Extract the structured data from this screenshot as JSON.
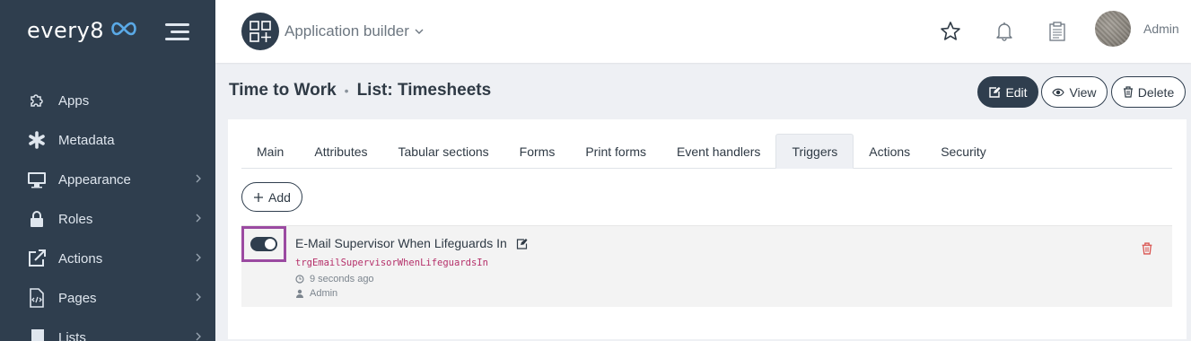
{
  "brand": {
    "name": "every8",
    "logo_icon": "infinity-icon"
  },
  "sidebar": {
    "items": [
      {
        "label": "Apps",
        "icon": "puzzle-icon",
        "chevron": false
      },
      {
        "label": "Metadata",
        "icon": "asterisk-icon",
        "chevron": false
      },
      {
        "label": "Appearance",
        "icon": "monitor-icon",
        "chevron": true
      },
      {
        "label": "Roles",
        "icon": "lock-icon",
        "chevron": true
      },
      {
        "label": "Actions",
        "icon": "external-link-icon",
        "chevron": true
      },
      {
        "label": "Pages",
        "icon": "code-file-icon",
        "chevron": true
      },
      {
        "label": "Lists",
        "icon": "book-icon",
        "chevron": true
      }
    ]
  },
  "topbar": {
    "app_selector_label": "Application builder",
    "user_name": "Admin"
  },
  "header": {
    "breadcrumb_root": "Time to Work",
    "breadcrumb_separator": "•",
    "title": "List: Timesheets",
    "edit_label": "Edit",
    "view_label": "View",
    "delete_label": "Delete"
  },
  "tabs": [
    {
      "label": "Main",
      "active": false
    },
    {
      "label": "Attributes",
      "active": false
    },
    {
      "label": "Tabular sections",
      "active": false
    },
    {
      "label": "Forms",
      "active": false
    },
    {
      "label": "Print forms",
      "active": false
    },
    {
      "label": "Event handlers",
      "active": false
    },
    {
      "label": "Triggers",
      "active": true
    },
    {
      "label": "Actions",
      "active": false
    },
    {
      "label": "Security",
      "active": false
    }
  ],
  "add_button_label": "Add",
  "trigger": {
    "enabled": true,
    "name": "E-Mail Supervisor When Lifeguards In",
    "code": "trgEmailSupervisorWhenLifeguardsIn",
    "time": "9 seconds ago",
    "author": "Admin"
  },
  "colors": {
    "sidebar_bg": "#2f3e4e",
    "accent_dark": "#2f3e4e",
    "highlight_border": "#9b4aa1",
    "code_text": "#b5306a",
    "danger": "#d9534f",
    "logo_accent": "#5aa9e6"
  }
}
